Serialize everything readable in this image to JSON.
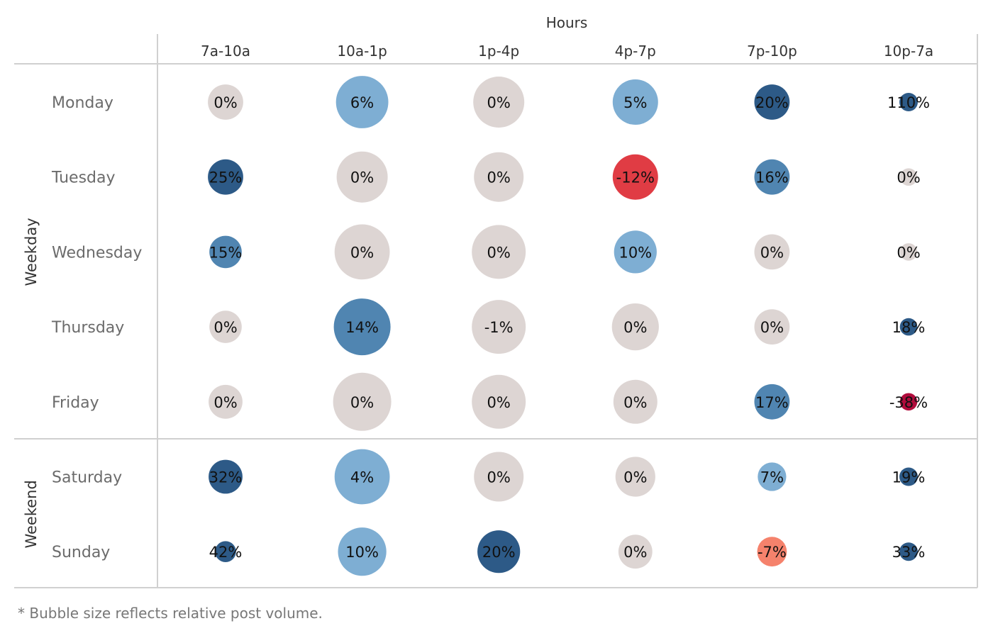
{
  "chart_data": {
    "type": "bubble-matrix",
    "title": "",
    "column_axis_title": "Hours",
    "columns": [
      "7a-10a",
      "10a-1p",
      "1p-4p",
      "4p-7p",
      "7p-10p",
      "10p-7a"
    ],
    "row_groups": [
      {
        "label": "Weekday",
        "rows": [
          "Monday",
          "Tuesday",
          "Wednesday",
          "Thursday",
          "Friday"
        ]
      },
      {
        "label": "Weekend",
        "rows": [
          "Saturday",
          "Sunday"
        ]
      }
    ],
    "rows": [
      "Monday",
      "Tuesday",
      "Wednesday",
      "Thursday",
      "Friday",
      "Saturday",
      "Sunday"
    ],
    "values_pct": [
      [
        0,
        6,
        0,
        5,
        20,
        110
      ],
      [
        25,
        0,
        0,
        -12,
        16,
        0
      ],
      [
        15,
        0,
        0,
        10,
        0,
        0
      ],
      [
        0,
        14,
        -1,
        0,
        0,
        18
      ],
      [
        0,
        0,
        0,
        0,
        17,
        -38
      ],
      [
        32,
        4,
        0,
        0,
        7,
        19
      ],
      [
        42,
        10,
        20,
        0,
        -7,
        33
      ]
    ],
    "labels": [
      [
        "0%",
        "6%",
        "0%",
        "5%",
        "20%",
        "110%"
      ],
      [
        "25%",
        "0%",
        "0%",
        "-12%",
        "16%",
        "0%"
      ],
      [
        "15%",
        "0%",
        "0%",
        "10%",
        "0%",
        "0%"
      ],
      [
        "0%",
        "14%",
        "-1%",
        "0%",
        "0%",
        "18%"
      ],
      [
        "0%",
        "0%",
        "0%",
        "0%",
        "17%",
        "-38%"
      ],
      [
        "32%",
        "4%",
        "0%",
        "0%",
        "7%",
        "19%"
      ],
      [
        "42%",
        "10%",
        "20%",
        "0%",
        "-7%",
        "33%"
      ]
    ],
    "relative_post_volume": [
      [
        0.37,
        0.81,
        0.77,
        0.61,
        0.37,
        0.1
      ],
      [
        0.37,
        0.77,
        0.73,
        0.61,
        0.37,
        0.09
      ],
      [
        0.31,
        0.9,
        0.86,
        0.54,
        0.37,
        0.09
      ],
      [
        0.31,
        0.95,
        0.86,
        0.65,
        0.37,
        0.09
      ],
      [
        0.34,
        1.0,
        0.86,
        0.57,
        0.37,
        0.09
      ],
      [
        0.34,
        0.9,
        0.73,
        0.47,
        0.24,
        0.1
      ],
      [
        0.13,
        0.69,
        0.54,
        0.34,
        0.26,
        0.1
      ]
    ],
    "color_scale": {
      "neutral": "#ddd5d3",
      "positive_light": "#7eaed3",
      "positive_mid": "#5085b1",
      "positive_dark": "#2d5a87",
      "negative_light": "#f5826c",
      "negative_mid": "#e03c44",
      "negative_dark": "#b10c3c"
    },
    "cell_colors": [
      [
        "neutral",
        "positive_light",
        "neutral",
        "positive_light",
        "positive_dark",
        "positive_dark"
      ],
      [
        "positive_dark",
        "neutral",
        "neutral",
        "negative_mid",
        "positive_mid",
        "neutral"
      ],
      [
        "positive_mid",
        "neutral",
        "neutral",
        "positive_light",
        "neutral",
        "neutral"
      ],
      [
        "neutral",
        "positive_mid",
        "neutral",
        "neutral",
        "neutral",
        "positive_dark"
      ],
      [
        "neutral",
        "neutral",
        "neutral",
        "neutral",
        "positive_mid",
        "negative_dark"
      ],
      [
        "positive_dark",
        "positive_light",
        "neutral",
        "neutral",
        "positive_light",
        "positive_dark"
      ],
      [
        "positive_dark",
        "positive_light",
        "positive_dark",
        "neutral",
        "negative_light",
        "positive_dark"
      ]
    ],
    "white_label_cells": [
      [
        3,
        1
      ]
    ],
    "footnote": "* Bubble size reflects relative post volume.",
    "legend": "none",
    "grid": false
  }
}
